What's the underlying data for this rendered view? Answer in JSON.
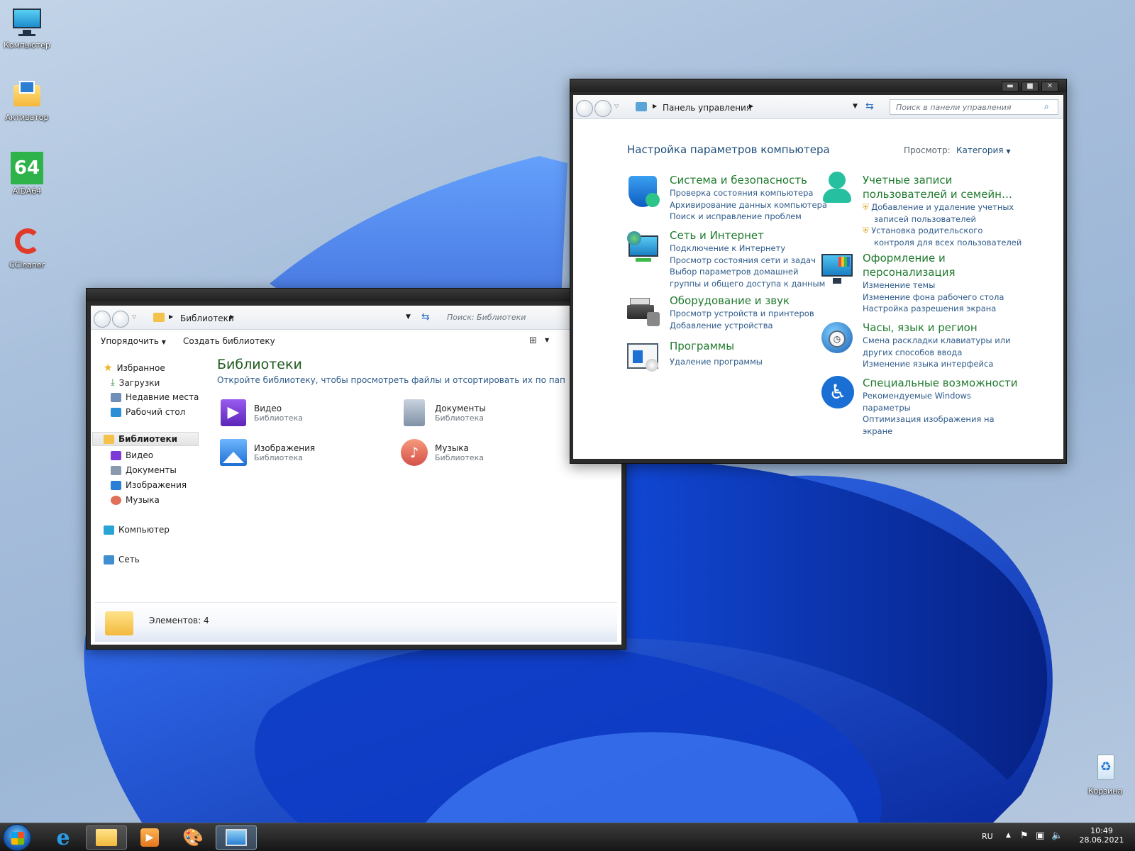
{
  "desktop": {
    "icons": [
      {
        "label": "Компьютер",
        "icon": "monitor-icon"
      },
      {
        "label": "Активатор",
        "icon": "activator-folder-icon"
      },
      {
        "label": "AIDA64",
        "icon": "aida64-icon",
        "badge": "64"
      },
      {
        "label": "CCleaner",
        "icon": "ccleaner-icon"
      },
      {
        "label": "Корзина",
        "icon": "recycle-bin-icon"
      }
    ]
  },
  "explorer": {
    "crumb": "Библиотеки",
    "search_placeholder": "Поиск: Библиотеки",
    "toolbar": {
      "organize": "Упорядочить",
      "create_library": "Создать библиотеку"
    },
    "nav": {
      "favorites": "Избранное",
      "downloads": "Загрузки",
      "recent": "Недавние места",
      "desktop": "Рабочий стол",
      "libraries": "Библиотеки",
      "video": "Видео",
      "documents": "Документы",
      "images": "Изображения",
      "music": "Музыка",
      "computer": "Компьютер",
      "network": "Сеть"
    },
    "title": "Библиотеки",
    "subtitle": "Откройте библиотеку, чтобы просмотреть файлы и отсортировать их по папке, дате и др",
    "libraries": [
      {
        "name": "Видео",
        "type": "Библиотека",
        "icon": "video-library-icon"
      },
      {
        "name": "Документы",
        "type": "Библиотека",
        "icon": "documents-library-icon"
      },
      {
        "name": "Изображения",
        "type": "Библиотека",
        "icon": "images-library-icon"
      },
      {
        "name": "Музыка",
        "type": "Библиотека",
        "icon": "music-library-icon"
      }
    ],
    "status": "Элементов: 4"
  },
  "control_panel": {
    "crumb": "Панель управления",
    "search_placeholder": "Поиск в панели управления",
    "heading": "Настройка параметров компьютера",
    "view_label": "Просмотр:",
    "view_value": "Категория",
    "categories": [
      {
        "title": "Система и безопасность",
        "links": [
          "Проверка состояния компьютера",
          "Архивирование данных компьютера",
          "Поиск и исправление проблем"
        ]
      },
      {
        "title": "Сеть и Интернет",
        "links": [
          "Подключение к Интернету",
          "Просмотр состояния сети и задач",
          "Выбор параметров домашней",
          "группы и общего доступа к данным"
        ]
      },
      {
        "title": "Оборудование и звук",
        "links": [
          "Просмотр устройств и принтеров",
          "Добавление устройства"
        ]
      },
      {
        "title": "Программы",
        "links": [
          "Удаление программы"
        ]
      },
      {
        "title": "Учетные записи",
        "title2": "пользователей и семейн…",
        "links": [
          "Добавление и удаление учетных",
          "записей пользователей",
          "Установка родительского",
          "контроля для всех пользователей"
        ]
      },
      {
        "title": "Оформление и",
        "title2": "персонализация",
        "links": [
          "Изменение темы",
          "Изменение фона рабочего стола",
          "Настройка разрешения экрана"
        ]
      },
      {
        "title": "Часы, язык и регион",
        "links": [
          "Смена раскладки клавиатуры или",
          "других способов ввода",
          "Изменение языка интерфейса"
        ]
      },
      {
        "title": "Специальные возможности",
        "links": [
          "Рекомендуемые Windows",
          "параметры",
          "Оптимизация изображения на",
          "экране"
        ]
      }
    ]
  },
  "taskbar": {
    "lang": "RU",
    "time": "10:49",
    "date": "28.06.2021"
  },
  "colors": {
    "accent": "#1f7a2e",
    "link": "#2e5a8a",
    "wallpaper_blue": "#1a4fd8"
  }
}
